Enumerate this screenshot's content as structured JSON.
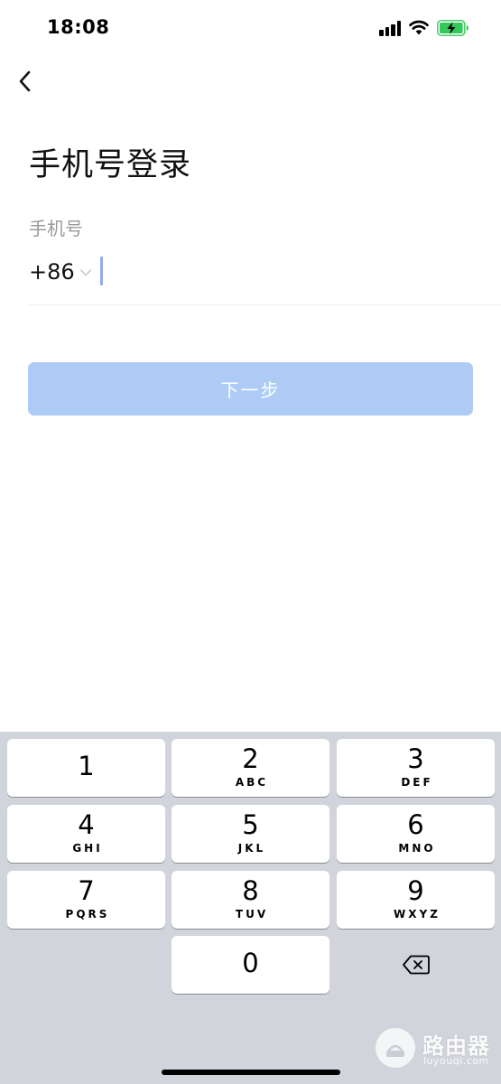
{
  "status_bar": {
    "time": "18:08",
    "battery_color": "#34c759"
  },
  "header": {
    "back_icon": "chevron-left-icon",
    "title": "手机号登录"
  },
  "form": {
    "phone_label": "手机号",
    "country_code": "+86",
    "phone_value": "",
    "phone_placeholder": ""
  },
  "actions": {
    "next_label": "下一步",
    "next_color": "#aecbf6"
  },
  "keypad": {
    "keys": [
      {
        "digit": "1",
        "letters": ""
      },
      {
        "digit": "2",
        "letters": "ABC"
      },
      {
        "digit": "3",
        "letters": "DEF"
      },
      {
        "digit": "4",
        "letters": "GHI"
      },
      {
        "digit": "5",
        "letters": "JKL"
      },
      {
        "digit": "6",
        "letters": "MNO"
      },
      {
        "digit": "7",
        "letters": "PQRS"
      },
      {
        "digit": "8",
        "letters": "TUV"
      },
      {
        "digit": "9",
        "letters": "WXYZ"
      },
      {
        "digit": "0",
        "letters": ""
      }
    ],
    "delete_icon": "backspace-icon"
  },
  "watermark": {
    "name": "路由器",
    "domain": "luyouqi.com"
  }
}
